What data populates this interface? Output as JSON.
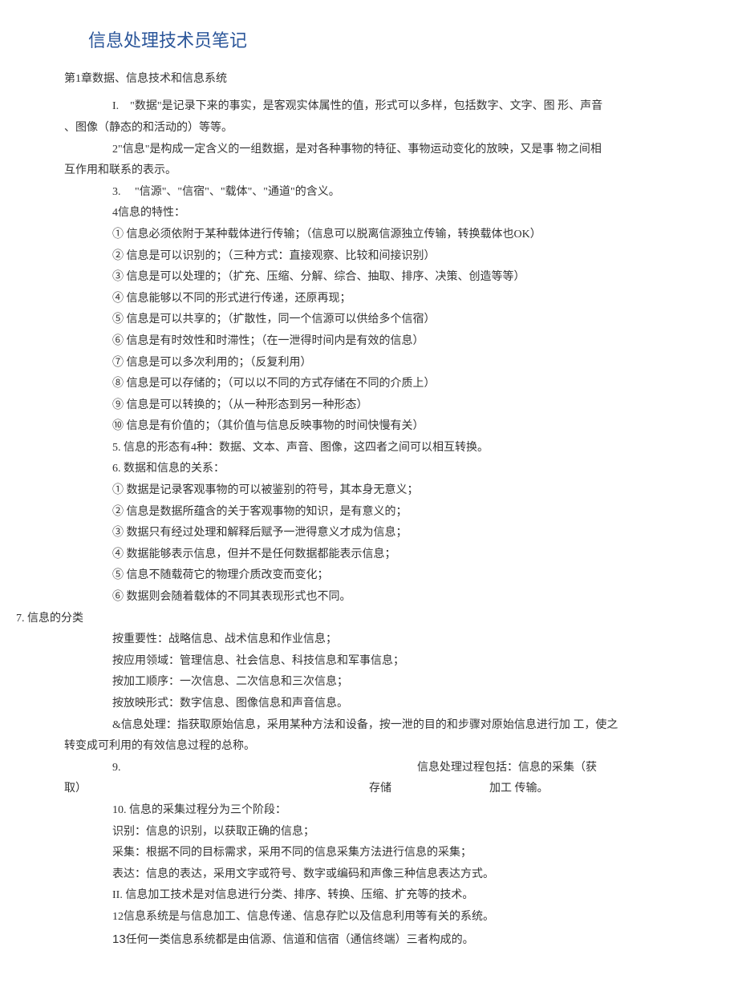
{
  "title": "信息处理技术员笔记",
  "chapter": "第1章数据、信息技术和信息系统",
  "p1_a": "I.　\"数据\"是记录下来的事实，是客观实体属性的值，形式可以多样，包括数字、文字、图 形、声音",
  "p1_b": "、图像（静态的和活动的）等等。",
  "p2_a": "2\"信息\"是构成一定含义的一组数据，是对各种事物的特征、事物运动变化的放映，又是事 物之间相",
  "p2_b": "互作用和联系的表示。",
  "p3": "3.　  \"信源\"、\"信宿\"、\"载体\"、\"通道\"的含义。",
  "p4": "4信息的特性：",
  "c1": "①  信息必须依附于某种载体进行传输；（信息可以脱离信源独立传输，转换载体也OK）",
  "c2": "②  信息是可以识别的；（三种方式：直接观察、比较和间接识别）",
  "c3": "③  信息是可以处理的；（扩充、压缩、分解、综合、抽取、排序、决策、创造等等）",
  "c4": "④  信息能够以不同的形式进行传递，还原再现；",
  "c5": "⑤  信息是可以共享的；（扩散性，同一个信源可以供给多个信宿）",
  "c6": "⑥  信息是有时效性和时滞性；（在一泄得时间内是有效的信息）",
  "c7": "⑦  信息是可以多次利用的；（反复利用）",
  "c8": "⑧  信息是可以存储的；（可以以不同的方式存储在不同的介质上）",
  "c9": "⑨  信息是可以转换的；（从一种形态到另一种形态）",
  "c10": "⑩  信息是有价值的；（其价值与信息反映事物的时间快慢有关）",
  "p5": "5.  信息的形态有4种：数据、文本、声音、图像，这四者之间可以相互转换。",
  "p6": "6.  数据和信息的关系：",
  "d1": "①  数据是记录客观事物的可以被鉴别的符号，其本身无意义；",
  "d2": "②  信息是数据所蕴含的关于客观事物的知识，是有意义的；",
  "d3": "③  数据只有经过处理和解释后赋予一泄得意义才成为信息；",
  "d4": "④  数据能够表示信息，但并不是任何数据都能表示信息；",
  "d5": "⑤  信息不随载荷它的物理介质改变而变化；",
  "d6": "⑥  数据则会随着载体的不同其表现形式也不同。",
  "p7": "7.   信息的分类",
  "s1": "按重要性：战略信息、战术信息和作业信息；",
  "s2": "按应用领域：管理信息、社会信息、科技信息和军事信息；",
  "s3": "按加工顺序：一次信息、二次信息和三次信息；",
  "s4": "按放映形式：数字信息、图像信息和声音信息。",
  "p8_a": "&信息处理：指获取原始信息，采用某种方法和设备，按一泄的目的和步骤对原始信息进行加 工，使之",
  "p8_b": "转变成可利用的有效信息过程的总称。",
  "p9_a1": "9.",
  "p9_a2": "信息处理过程包括：信息的采集（获",
  "p9_b1": "取）",
  "p9_b2": "存储",
  "p9_b3": "加工 传输。",
  "p10": "10. 信息的采集过程分为三个阶段：",
  "s10a": "识别：信息的识别，以获取正确的信息；",
  "s10b": "采集：根据不同的目标需求，采用不同的信息采集方法进行信息的采集；",
  "s10c": "表达：信息的表达，采用文字或符号、数字或编码和声像三种信息表达方式。",
  "p11": "II.  信息加工技术是对信息进行分类、排序、转换、压缩、扩充等的技术。",
  "p12": "12信息系统是与信息加工、信息传递、信息存贮以及信息利用等有关的系统。",
  "p13_num": "13",
  "p13_txt": "任何一类信息系统都是由信源、信道和信宿（通信终端）三者构成的。"
}
